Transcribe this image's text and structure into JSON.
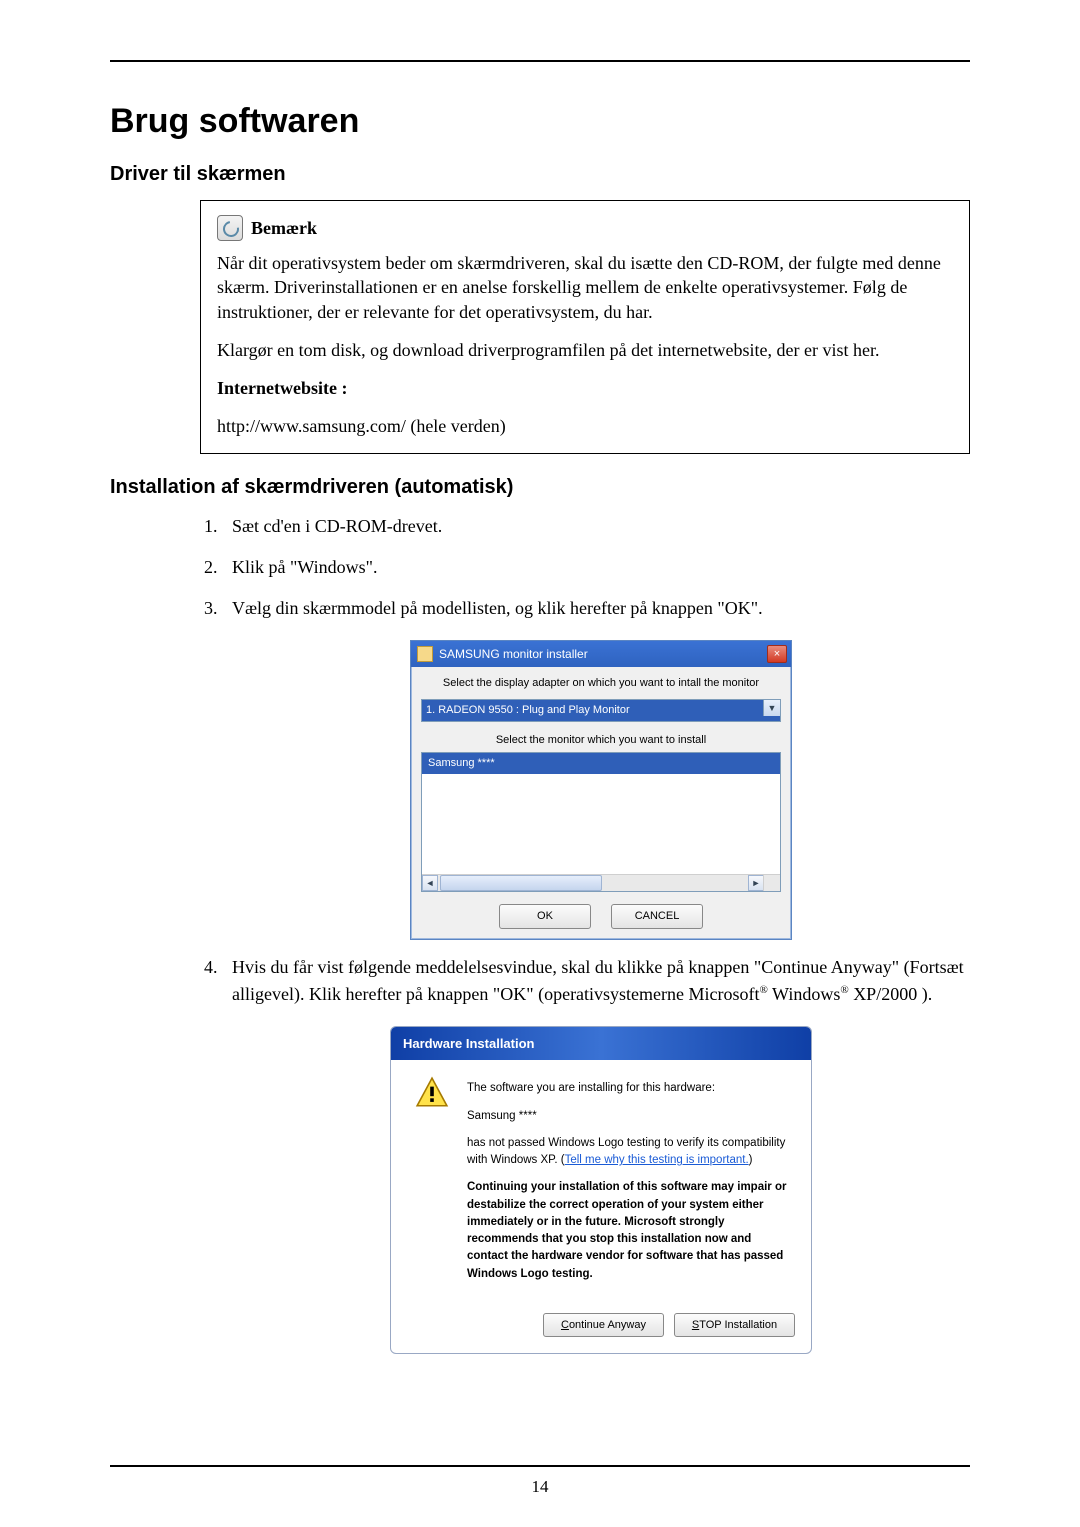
{
  "page": {
    "title": "Brug softwaren",
    "number": "14"
  },
  "section1": {
    "heading": "Driver til skærmen",
    "note": {
      "label": "Bemærk",
      "para1": "Når dit operativsystem beder om skærmdriveren, skal du isætte den CD-ROM, der fulgte med denne skærm. Driverinstallationen er en anelse forskellig mellem de enkelte operativsystemer. Følg de instruktioner, der er relevante for det operativsystem, du har.",
      "para2": "Klargør en tom disk, og download driverprogramfilen på det internetwebsite, der er vist her.",
      "websiteLabel": "Internetwebsite :",
      "websiteUrl": "http://www.samsung.com/ (hele verden)"
    }
  },
  "section2": {
    "heading": "Installation af skærmdriveren (automatisk)",
    "steps": {
      "s1": "Sæt cd'en i CD-ROM-drevet.",
      "s2": "Klik på \"Windows\".",
      "s3": "Vælg din skærmmodel på modellisten, og klik herefter på knappen \"OK\".",
      "s4_pre": "Hvis du får vist følgende meddelelsesvindue, skal du klikke på knappen \"Continue Anyway\" (Fortsæt alligevel). Klik herefter på knappen \"OK\" (operativsystemerne Microsoft",
      "s4_mid": " Windows",
      "s4_post": " XP/2000 ).",
      "reg": "®"
    }
  },
  "installer": {
    "title": "SAMSUNG monitor installer",
    "close": "×",
    "line1": "Select the display adapter on which you want to intall the monitor",
    "select": "1. RADEON 9550 : Plug and Play Monitor",
    "line2": "Select the monitor which you want to install",
    "item": "Samsung ****",
    "ok": "OK",
    "cancel": "CANCEL"
  },
  "hw": {
    "title": "Hardware Installation",
    "line1": "The software you are installing for this hardware:",
    "line2": "Samsung ****",
    "line3_pre": "has not passed Windows Logo testing to verify its compatibility with Windows XP. (",
    "line3_link": "Tell me why this testing is important.",
    "line3_post": ")",
    "warn": "Continuing your installation of this software may impair or destabilize the correct operation of your system either immediately or in the future. Microsoft strongly recommends that you stop this installation now and contact the hardware vendor for software that has passed Windows Logo testing.",
    "btn1_u": "C",
    "btn1_rest": "ontinue Anyway",
    "btn2_u": "S",
    "btn2_rest": "TOP Installation"
  }
}
